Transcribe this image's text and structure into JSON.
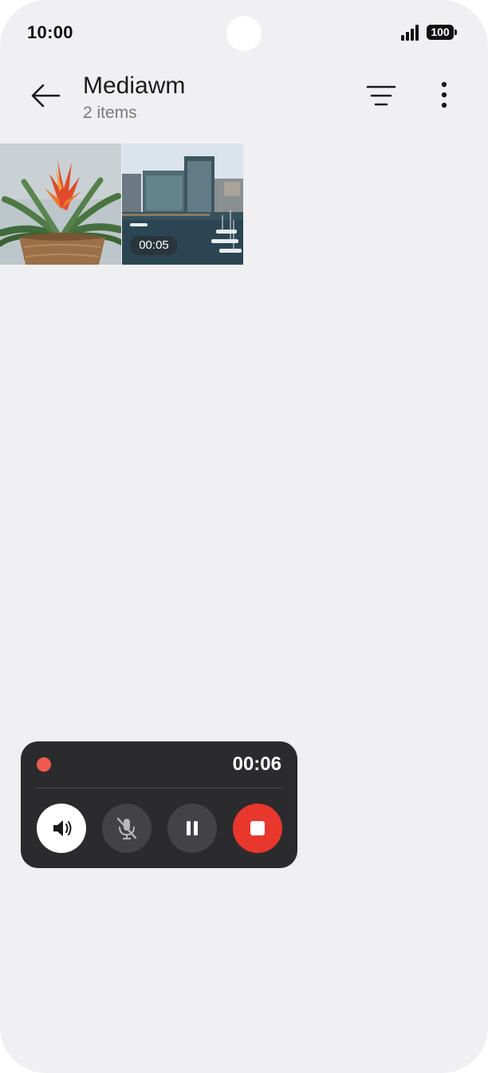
{
  "status_bar": {
    "time": "10:00",
    "battery": "100"
  },
  "header": {
    "title": "Mediawm",
    "subtitle": "2 items"
  },
  "icons": {
    "back": "arrow-left-icon",
    "filter": "filter-lines-icon",
    "more": "more-vertical-icon",
    "speaker": "speaker-icon",
    "mic_off": "microphone-off-icon",
    "pause": "pause-icon",
    "stop": "stop-icon"
  },
  "media": [
    {
      "kind": "photo",
      "subject": "potted bromeliad plant"
    },
    {
      "kind": "video",
      "subject": "waterfront buildings and marina",
      "duration": "00:05"
    }
  ],
  "recorder": {
    "elapsed": "00:06",
    "colors": {
      "panel": "#2b2b2d",
      "record": "#ee5a4f",
      "stop": "#e8372c"
    }
  }
}
